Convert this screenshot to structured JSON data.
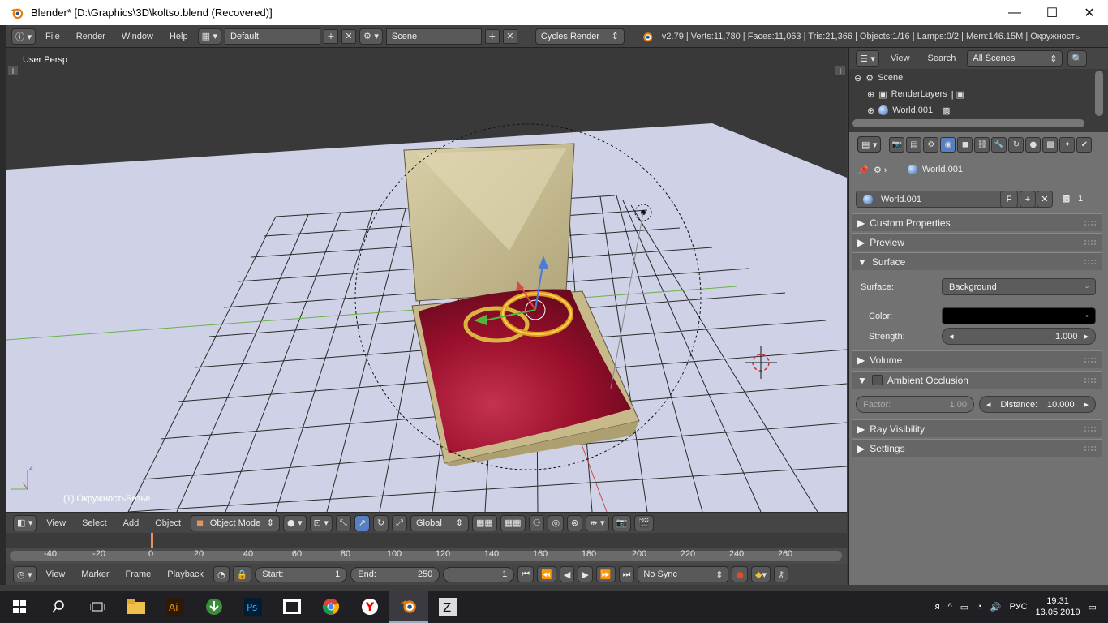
{
  "window": {
    "title": "Blender* [D:\\Graphics\\3D\\koltso.blend (Recovered)]",
    "minimize": "—",
    "maximize": "☐",
    "close": "✕"
  },
  "info_header": {
    "menus": [
      "File",
      "Render",
      "Window",
      "Help"
    ],
    "layout": "Default",
    "scene": "Scene",
    "engine": "Cycles Render",
    "stats": "v2.79 | Verts:11,780 | Faces:11,063 | Tris:21,366 | Objects:1/16 | Lamps:0/2 | Mem:146.15M | Окружность"
  },
  "viewport": {
    "label": "User Persp",
    "active_object": "(1) ОкружностьБезье",
    "colors": {
      "box_outer": "#c7b98a",
      "cushion": "#a0102f",
      "ring": "#d9b441",
      "grid": "#2a2a2a",
      "floor": "#cfd2e6"
    }
  },
  "viewport_header": {
    "menus": [
      "View",
      "Select",
      "Add",
      "Object"
    ],
    "mode": "Object Mode",
    "orientation": "Global"
  },
  "timeline": {
    "ticks": [
      "-40",
      "-20",
      "0",
      "20",
      "40",
      "60",
      "80",
      "100",
      "120",
      "140",
      "160",
      "180",
      "200",
      "220",
      "240",
      "260"
    ],
    "current_frame": 1
  },
  "timeline_header": {
    "menus": [
      "View",
      "Marker",
      "Frame",
      "Playback"
    ],
    "start_label": "Start:",
    "start_value": "1",
    "end_label": "End:",
    "end_value": "250",
    "frame_value": "1",
    "sync": "No Sync"
  },
  "outliner": {
    "menus": [
      "View",
      "Search"
    ],
    "filter": "All Scenes",
    "items": [
      "Scene",
      "RenderLayers",
      "World.001"
    ]
  },
  "properties": {
    "breadcrumb": "World.001",
    "datablock": "World.001",
    "fake_user": "F",
    "users": "1",
    "panels": {
      "custom_properties": "Custom Properties",
      "preview": "Preview",
      "surface": "Surface",
      "volume": "Volume",
      "ambient_occlusion": "Ambient Occlusion",
      "ray_visibility": "Ray Visibility",
      "settings": "Settings"
    },
    "surface_label": "Surface:",
    "surface_value": "Background",
    "color_label": "Color:",
    "strength_label": "Strength:",
    "strength_value": "1.000",
    "factor_label": "Factor:",
    "factor_value": "1.00",
    "distance_label": "Distance:",
    "distance_value": "10.000"
  },
  "taskbar": {
    "lang": "РУС",
    "time": "19:31",
    "date": "13.05.2019"
  }
}
